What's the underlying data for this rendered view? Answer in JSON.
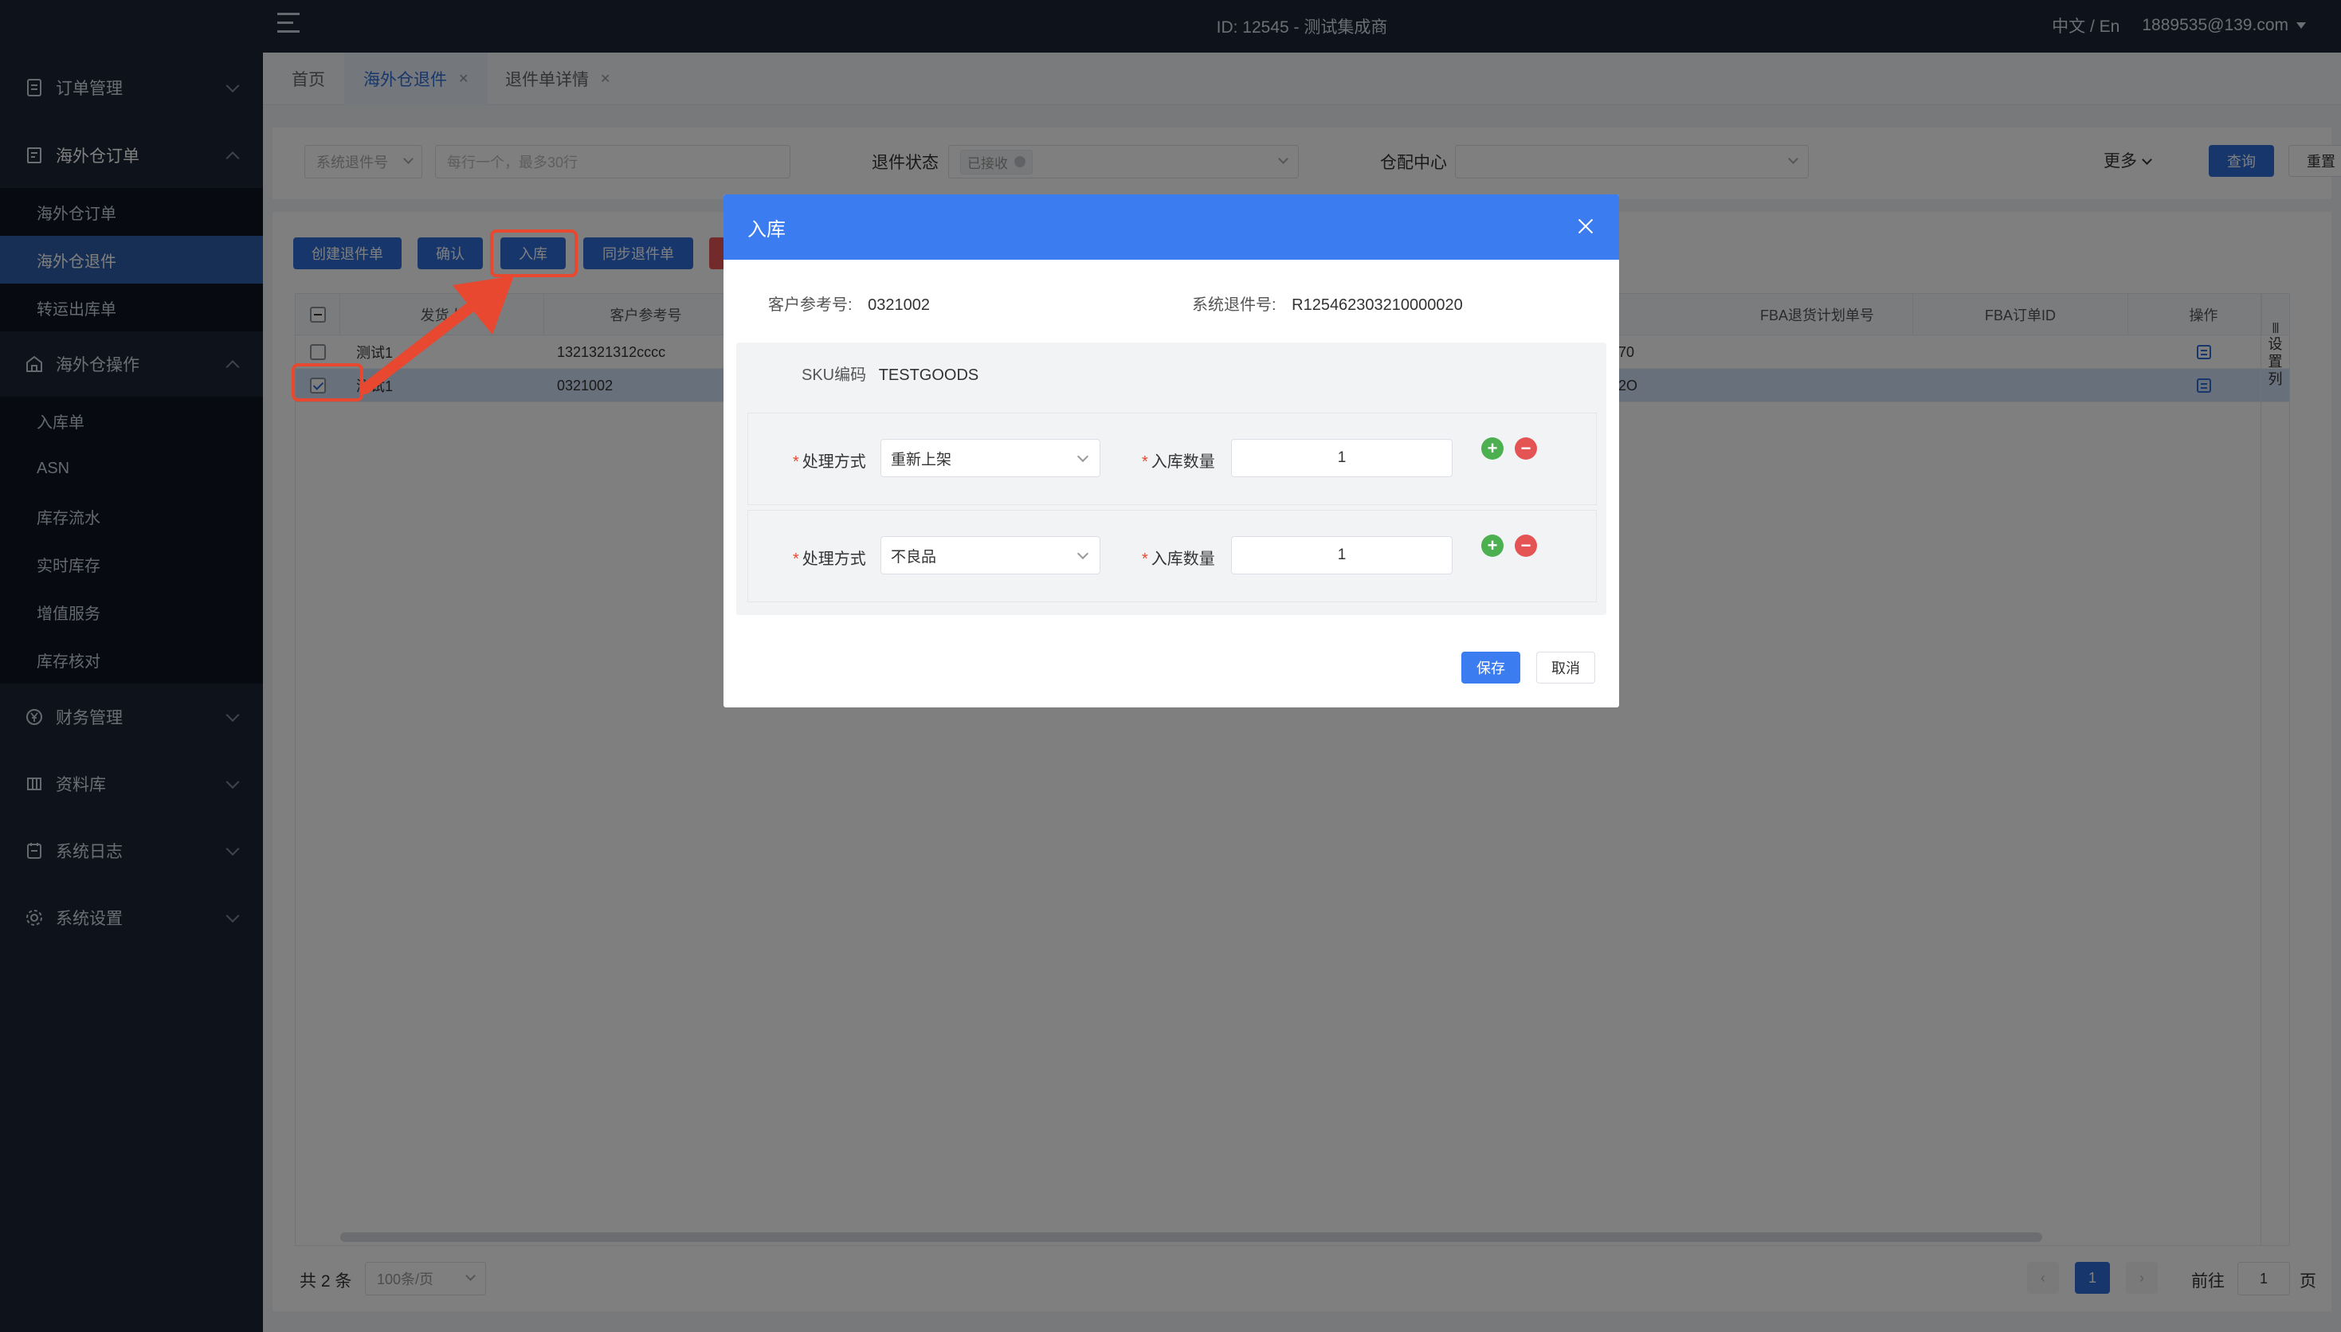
{
  "topbar": {
    "title": "ID: 12545 - 测试集成商",
    "lang": "中文 / En",
    "user": "1889535@139.com"
  },
  "sidebar": {
    "groups": [
      {
        "label": "订单管理",
        "icon": "document-icon"
      },
      {
        "label": "海外仓订单",
        "icon": "order-list-icon"
      },
      {
        "label": "海外仓操作",
        "icon": "warehouse-icon"
      },
      {
        "label": "财务管理",
        "icon": "yen-icon"
      },
      {
        "label": "资料库",
        "icon": "grid-icon"
      },
      {
        "label": "系统日志",
        "icon": "log-icon"
      },
      {
        "label": "系统设置",
        "icon": "gear-icon"
      }
    ],
    "orders_sub": [
      "海外仓订单",
      "海外仓退件",
      "转运出库单"
    ],
    "ops_sub": [
      "入库单",
      "ASN",
      "库存流水",
      "实时库存",
      "增值服务",
      "库存核对"
    ]
  },
  "tabs": [
    {
      "label": "首页"
    },
    {
      "label": "海外仓退件"
    },
    {
      "label": "退件单详情"
    }
  ],
  "filters": {
    "type_select": "系统退件号",
    "search_placeholder": "每行一个，最多30行",
    "status_label": "退件状态",
    "status_tag": "已接收",
    "warehouse_label": "仓配中心",
    "more": "更多",
    "query": "查询",
    "reset": "重置"
  },
  "toolbar": {
    "create": "创建退件单",
    "confirm": "确认",
    "inbound": "入库",
    "sync": "同步退件单"
  },
  "table": {
    "headers": [
      "发货人",
      "客户参考号",
      "FBA退货计划单号",
      "FBA订单ID",
      "操作"
    ],
    "settings": [
      "设",
      "置",
      "列"
    ],
    "rows": [
      {
        "shipper": "测试1",
        "ref": "1321321312cccc",
        "tail": "70",
        "checked": false
      },
      {
        "shipper": "测试1",
        "ref": "0321002",
        "tail": "2O",
        "checked": true
      }
    ]
  },
  "pagination": {
    "total": "共 2 条",
    "page_size": "100条/页",
    "current": "1",
    "goto_label": "前往",
    "goto_value": "1",
    "page_suffix": "页"
  },
  "modal": {
    "title": "入库",
    "ref_label": "客户参考号:",
    "ref_value": "0321002",
    "sys_label": "系统退件号:",
    "sys_value": "R125462303210000020",
    "sku_label": "SKU编码",
    "sku_value": "TESTGOODS",
    "lines": [
      {
        "method_label": "处理方式",
        "method": "重新上架",
        "qty_label": "入库数量",
        "qty": "1"
      },
      {
        "method_label": "处理方式",
        "method": "不良品",
        "qty_label": "入库数量",
        "qty": "1"
      }
    ],
    "save": "保存",
    "cancel": "取消"
  },
  "colors": {
    "accent": "#2f6fd8",
    "modal_header": "#3b7cf0",
    "highlight": "#e8482f",
    "sidebar": "#1d2535"
  }
}
